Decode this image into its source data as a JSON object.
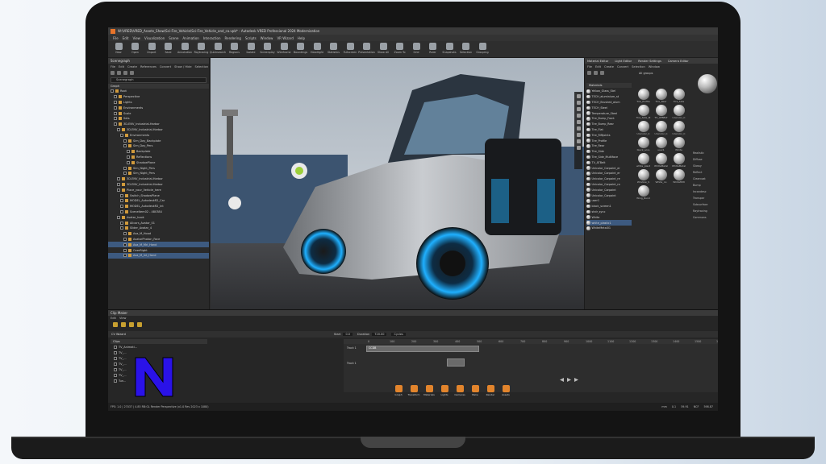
{
  "app": {
    "title": "W:\\VRED\\VRED_Assets_Show\\Sci-Fire_Vehicle\\Sci-Fire_Vehicle_and_ca.vpb* - Autodesk VRED Professional 2024 Modernization",
    "menu": [
      "File",
      "Edit",
      "View",
      "Visualization",
      "Scene",
      "Animation",
      "Interaction",
      "Rendering",
      "Scripts",
      "Window",
      "VR Wizard",
      "Help"
    ]
  },
  "toolbar": [
    "New",
    "Open",
    "Import",
    "Save",
    "Annotation",
    "Raytracing",
    "Quicksearch",
    "Regions",
    "Isolate",
    "Screenplay",
    "Wireframe",
    "Boundings",
    "Headlight",
    "Statistics",
    "Fullscreen",
    "Presentation",
    "Show All",
    "Zoom To",
    "Grid",
    "Ruler",
    "Snapshots",
    "Selection",
    "Grouping"
  ],
  "scenegraph": {
    "title": "Scenegraph",
    "menu": [
      "File",
      "Edit",
      "Create",
      "References",
      "Convert",
      "Show / Hide",
      "Selection"
    ],
    "search_placeholder": "Scenegraph",
    "tree_header": "Graph",
    "rows": [
      {
        "label": "Root",
        "sel": false
      },
      {
        "label": "Perspective",
        "sel": false
      },
      {
        "label": "Lights",
        "sel": false
      },
      {
        "label": "Environments",
        "sel": false
      },
      {
        "label": "Scale",
        "sel": false
      },
      {
        "label": "Sets",
        "sel": false
      },
      {
        "label": "3D-ENV_Industrial-Harbor",
        "sel": false
      },
      {
        "label": "3D-ENV_Industrial-Harbor",
        "sel": false
      },
      {
        "label": "Environments",
        "sel": false
      },
      {
        "label": "Sim_Day_Backplate",
        "sel": false
      },
      {
        "label": "Sim_Day_Pers",
        "sel": false
      },
      {
        "label": "Backplate",
        "sel": false
      },
      {
        "label": "Reflections",
        "sel": false
      },
      {
        "label": "ShadowPlane",
        "sel": false
      },
      {
        "label": "Sim_Night_Pers",
        "sel": false
      },
      {
        "label": "Sim_Night_Pers",
        "sel": false
      },
      {
        "label": "3D-ENV_Industrial-Harbor",
        "sel": false
      },
      {
        "label": "3D-ENV_Industrial-Harbor",
        "sel": false
      },
      {
        "label": "Place_your_Vehicle_here",
        "sel": false
      },
      {
        "label": "Switch_ShadowPlane",
        "sel": false
      },
      {
        "label": "MODEL_AutodeskR2_Car",
        "sel": false
      },
      {
        "label": "MODEL_AutodeskR2_Int",
        "sel": false
      },
      {
        "label": "Sceneltem02 - 480384",
        "sel": false
      },
      {
        "label": "Avatar_hook",
        "sel": false
      },
      {
        "label": "Allcars_Avatar_01",
        "sel": false
      },
      {
        "label": "Slider_Avatar_4",
        "sel": false
      },
      {
        "label": "Ava_M_Hood",
        "sel": false
      },
      {
        "label": "AvatarPhoton_Face",
        "sel": false
      },
      {
        "label": "Ava_M_Mri_Hand",
        "sel": true
      },
      {
        "label": "OverRight",
        "sel": false
      },
      {
        "label": "Ava_M_Int_Hand",
        "sel": true
      }
    ]
  },
  "material_editor": {
    "tabs": [
      "Material Editor",
      "Light Editor",
      "Render Settings",
      "Camera Editor"
    ],
    "menu": [
      "File",
      "Edit",
      "Create",
      "Convert",
      "Selection",
      "Window"
    ],
    "list_header": "Materials",
    "group_label": "All groups",
    "materials": [
      {
        "label": "Yellow_Glass_Stel",
        "sel": false
      },
      {
        "label": "TECH_aluminium_st",
        "sel": false
      },
      {
        "label": "TECH_Brushed_alum",
        "sel": false
      },
      {
        "label": "TECH_Steel",
        "sel": false
      },
      {
        "label": "Temperature_Steel",
        "sel": false
      },
      {
        "label": "Tire_Bump_Front",
        "sel": false
      },
      {
        "label": "Tire_Bump_Rear",
        "sel": false
      },
      {
        "label": "Tire_Flat",
        "sel": false
      },
      {
        "label": "Tire_RiftJoints",
        "sel": false
      },
      {
        "label": "Tire_Profile",
        "sel": false
      },
      {
        "label": "Tire_Rear",
        "sel": false
      },
      {
        "label": "Tire_Side",
        "sel": false
      },
      {
        "label": "Tire_Side_Multiface",
        "sel": false
      },
      {
        "label": "TV_ATBelt",
        "sel": false
      },
      {
        "label": "Unicolor_Carpaint_er",
        "sel": false
      },
      {
        "label": "Unicolor_Carpaint_er",
        "sel": false
      },
      {
        "label": "Unicolor_Carpaint_re",
        "sel": false
      },
      {
        "label": "Unicolor_Carpaint_ro",
        "sel": false
      },
      {
        "label": "Unicolor_Carpaint",
        "sel": false
      },
      {
        "label": "Unicolor_Carpaint",
        "sel": false
      },
      {
        "label": "user1",
        "sel": false
      },
      {
        "label": "black_screen1",
        "sel": false
      },
      {
        "label": "shdr_sync",
        "sel": false
      },
      {
        "label": "White",
        "sel": false
      },
      {
        "label": "white_plastic1",
        "sel": true
      },
      {
        "label": "WhiteMetal01",
        "sel": false
      }
    ],
    "swatches": [
      "Tire_Profile",
      "Tire_Rear",
      "Tire_Side",
      "Tire_Side_M",
      "TV_ATBELT",
      "Unicolor_C",
      "Unicolor_C",
      "Unicolor_C",
      "Unicolor_C",
      "black_scre",
      "user1",
      "White",
      "white_plast",
      "WhiteMetal",
      "WhiteMetal",
      "Window_S",
      "White_no",
      "WhiteMtlt",
      "Wing_Rund"
    ],
    "props": [
      "Realistic",
      "Diffuse",
      "Glossy",
      "Reflect",
      "Clearcoat",
      "Bump",
      "Incandesc",
      "Transpar",
      "Subsurface",
      "Raytracing",
      "Commons"
    ]
  },
  "clip_maker": {
    "title": "Clip Maker",
    "menu": [
      "Edit",
      "View"
    ],
    "timebar": {
      "start_label": "Start",
      "start": "0.0",
      "duration_label": "Duration",
      "duration": "720.00",
      "mode": "Cycles"
    },
    "clips_header": "Clips",
    "clips": [
      "TV_Animati...",
      "TV_...",
      "TV_...",
      "TV_...",
      "TV_...",
      "TV_...",
      "Tun..."
    ],
    "ruler": [
      "0",
      "100",
      "200",
      "300",
      "400",
      "500",
      "600",
      "700",
      "800",
      "900",
      "1000",
      "1100",
      "1200",
      "1300",
      "1400",
      "1500",
      "1600"
    ],
    "tracks": [
      "Track 1",
      "Track 1"
    ],
    "clip_block_label": "CCDB",
    "wizard_label": "CV Wizard"
  },
  "dock": [
    "Graph",
    "Transform",
    "Materials",
    "Lights",
    "Cameras",
    "Bake",
    "Render",
    "Assets"
  ],
  "status": {
    "left": "FPS: 1.0 | 27037 | 4.85 RB:GL Render Perspective (x1.0 Rev 2023 x 1080)",
    "right_units": "mm",
    "right_zoom": "0.1",
    "right_value": "59.91",
    "right_mode": "NCF",
    "right_frame": "598.87"
  },
  "logo_letter": "N",
  "colors": {
    "accent": "#e2842c",
    "selection": "#3d5a80",
    "logo": "#2a12e8"
  }
}
